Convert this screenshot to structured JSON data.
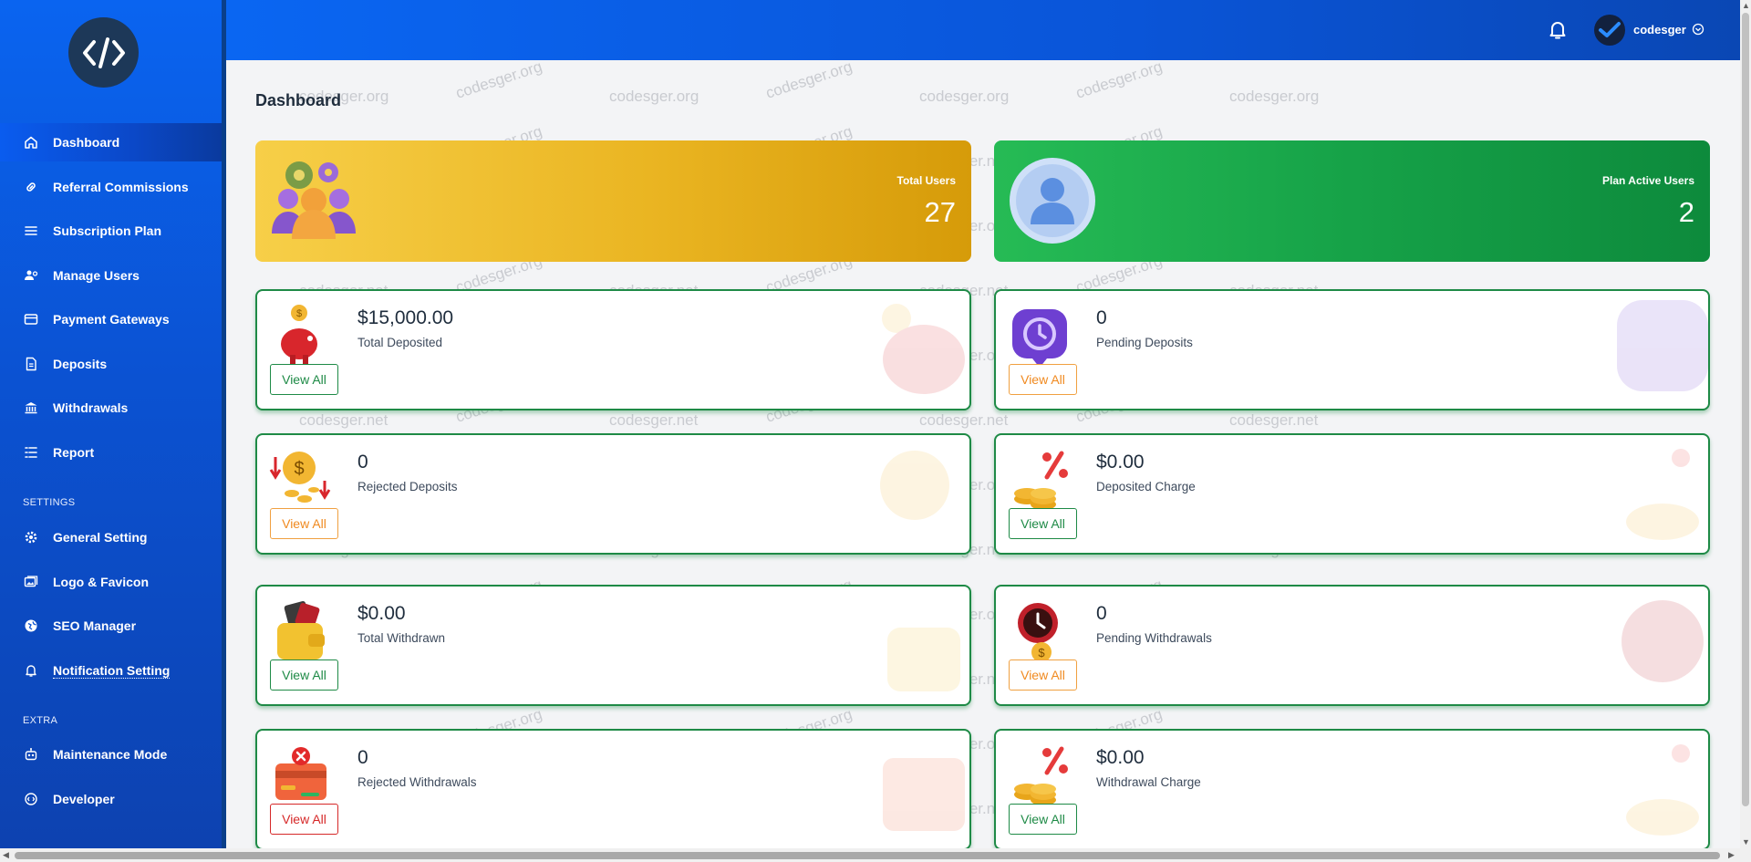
{
  "app": {
    "username": "codesger"
  },
  "sidebar": {
    "items": [
      {
        "label": "Dashboard",
        "icon": "home-icon"
      },
      {
        "label": "Referral Commissions",
        "icon": "link-icon"
      },
      {
        "label": "Subscription Plan",
        "icon": "list-icon"
      },
      {
        "label": "Manage Users",
        "icon": "users-gear-icon"
      },
      {
        "label": "Payment Gateways",
        "icon": "credit-card-icon"
      },
      {
        "label": "Deposits",
        "icon": "document-icon"
      },
      {
        "label": "Withdrawals",
        "icon": "bank-icon"
      },
      {
        "label": "Report",
        "icon": "report-list-icon"
      }
    ],
    "settings_label": "SETTINGS",
    "settings_items": [
      {
        "label": "General Setting",
        "icon": "gear-icon"
      },
      {
        "label": "Logo & Favicon",
        "icon": "images-icon"
      },
      {
        "label": "SEO Manager",
        "icon": "globe-icon"
      },
      {
        "label": "Notification Setting",
        "icon": "bell-icon"
      }
    ],
    "extra_label": "EXTRA",
    "extra_items": [
      {
        "label": "Maintenance Mode",
        "icon": "robot-icon"
      },
      {
        "label": "Developer",
        "icon": "code-icon"
      }
    ]
  },
  "main": {
    "title": "Dashboard",
    "top_cards": [
      {
        "label": "Total Users",
        "value": "27"
      },
      {
        "label": "Plan Active Users",
        "value": "2"
      }
    ],
    "cards": [
      {
        "value": "$15,000.00",
        "label": "Total Deposited",
        "button": "View All"
      },
      {
        "value": "0",
        "label": "Pending Deposits",
        "button": "View All"
      },
      {
        "value": "0",
        "label": "Rejected Deposits",
        "button": "View All"
      },
      {
        "value": "$0.00",
        "label": "Deposited Charge",
        "button": "View All"
      },
      {
        "value": "$0.00",
        "label": "Total Withdrawn",
        "button": "View All"
      },
      {
        "value": "0",
        "label": "Pending Withdrawals",
        "button": "View All"
      },
      {
        "value": "0",
        "label": "Rejected Withdrawals",
        "button": "View All"
      },
      {
        "value": "$0.00",
        "label": "Withdrawal Charge",
        "button": "View All"
      }
    ]
  },
  "watermarks": [
    "codesger.net",
    "codesger.org"
  ],
  "colors": {
    "primary": "#0a5ce8",
    "success": "#1e8a46",
    "warning": "#f08a20",
    "danger": "#d62828",
    "gold": "#eab522"
  }
}
